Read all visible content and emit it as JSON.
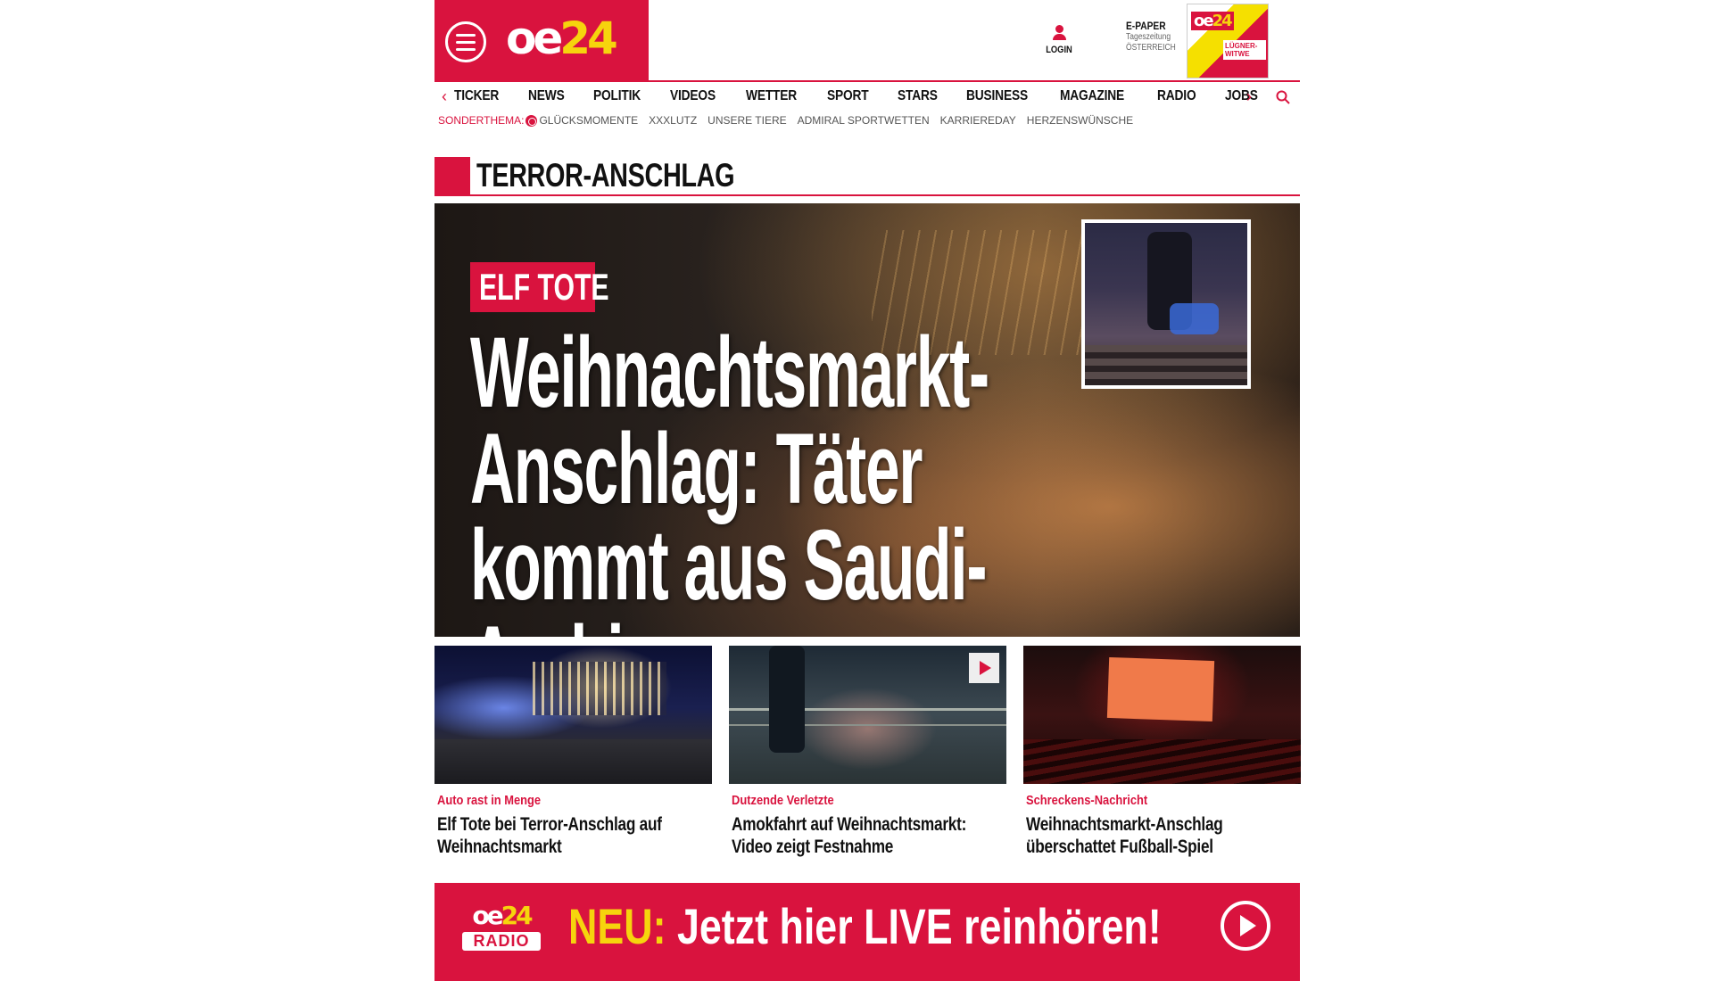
{
  "header": {
    "logo_main": "oe",
    "logo_accent": "24",
    "login_label": "LOGIN",
    "epaper_title": "E-PAPER",
    "epaper_sub1": "Tageszeitung",
    "epaper_sub2": "ÖSTERREICH",
    "epaper_cover_headline": "LÜGNER-WITWE"
  },
  "nav": {
    "items": [
      "TICKER",
      "NEWS",
      "POLITIK",
      "VIDEOS",
      "WETTER",
      "SPORT",
      "STARS",
      "BUSINESS",
      "MAGAZINE",
      "RADIO",
      "JOBS"
    ]
  },
  "subnav": {
    "label": "SONDERTHEMA:",
    "items": [
      "GLÜCKSMOMENTE",
      "XXXLUTZ",
      "UNSERE TIERE",
      "ADMIRAL SPORTWETTEN",
      "KARRIEREDAY",
      "HERZENSWÜNSCHE"
    ]
  },
  "section": {
    "title": "TERROR-ANSCHLAG"
  },
  "hero": {
    "badge": "ELF TOTE",
    "headline_1": "Weihnachtsmarkt-",
    "headline_2": "Anschlag: Täter",
    "headline_3": "kommt aus Saudi-Arabien"
  },
  "cards": [
    {
      "kicker": "Auto rast in Menge",
      "title": "Elf Tote bei Terror-Anschlag auf Weihnachtsmarkt"
    },
    {
      "kicker": "Dutzende Verletzte",
      "title": "Amokfahrt auf Weihnachtsmarkt: Video zeigt Festnahme"
    },
    {
      "kicker": "Schreckens-Nachricht",
      "title": "Weihnachtsmarkt-Anschlag überschattet Fußball-Spiel"
    }
  ],
  "radio": {
    "logo_top_main": "oe",
    "logo_top_accent": "24",
    "logo_bottom": "RADIO",
    "neu": "NEU:",
    "cta": "Jetzt hier LIVE reinhören!"
  },
  "colors": {
    "brand_red": "#d9133e",
    "brand_yellow": "#f6d40d"
  },
  "icons": {
    "menu": "hamburger-menu-icon",
    "login": "user-icon",
    "search": "search-icon",
    "play": "play-icon"
  }
}
